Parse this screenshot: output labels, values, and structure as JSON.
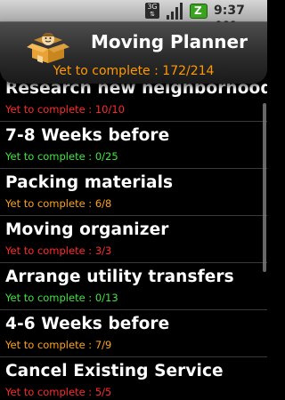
{
  "status_bar": {
    "network_badge": "3G",
    "time": "9:37 AM",
    "icons": [
      "3g-icon",
      "signal-icon",
      "battery-icon"
    ]
  },
  "header": {
    "app_title": "Moving Planner",
    "logo_icon": "moving-box-icon",
    "summary": "Yet to complete : 172/214"
  },
  "colors": {
    "red": "#ff2a2a",
    "green": "#3ee63e",
    "orange": "#ffa21a",
    "header_summary": "#ff9900"
  },
  "list": {
    "items": [
      {
        "title": "Research new neighborhood",
        "status": "Yet to complete : 10/10",
        "status_color": "red"
      },
      {
        "title": "7-8 Weeks before",
        "status": "Yet to complete : 0/25",
        "status_color": "green"
      },
      {
        "title": "Packing materials",
        "status": "Yet to complete : 6/8",
        "status_color": "orange"
      },
      {
        "title": "Moving organizer",
        "status": "Yet to complete : 3/3",
        "status_color": "red"
      },
      {
        "title": "Arrange utility transfers",
        "status": "Yet to complete : 0/13",
        "status_color": "green"
      },
      {
        "title": "4-6 Weeks before",
        "status": "Yet to complete : 7/9",
        "status_color": "orange"
      },
      {
        "title": "Cancel Existing Service",
        "status": "Yet to complete : 5/5",
        "status_color": "red"
      }
    ]
  }
}
